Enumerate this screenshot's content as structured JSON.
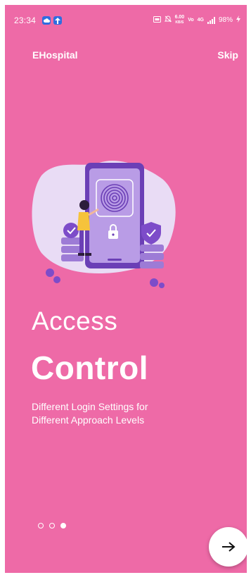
{
  "status_bar": {
    "time": "23:34",
    "speed_value": "6.00",
    "speed_unit": "KB/S",
    "net_label": "Vo",
    "net_type": "4G",
    "battery": "98%"
  },
  "header": {
    "app_title": "EHospital",
    "skip_label": "Skip"
  },
  "slide": {
    "title_light": "Access",
    "title_bold": "Control",
    "description": "Different Login Settings for Different Approach Levels"
  },
  "pager": {
    "total": 3,
    "active_index": 2
  },
  "colors": {
    "background": "#ee6aa7",
    "illustration_blob": "#e9dcf5",
    "phone": "#6b3fb6",
    "accent_purple": "#7d4cc9"
  },
  "icons": {
    "next": "arrow-right-icon",
    "fingerprint": "fingerprint-icon",
    "lock": "lock-icon",
    "shield": "shield-check-icon"
  }
}
